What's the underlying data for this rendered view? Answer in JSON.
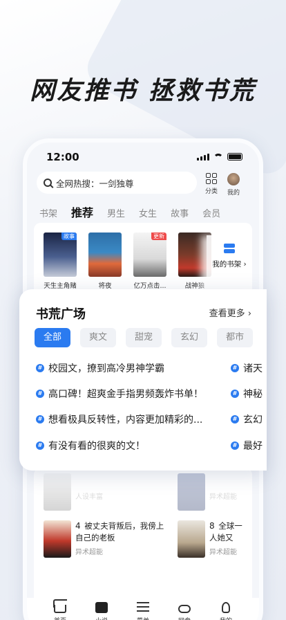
{
  "headline": "网友推书 拯救书荒",
  "status": {
    "time": "12:00"
  },
  "search": {
    "text": "全网热搜：一剑独尊"
  },
  "top_actions": {
    "category": "分类",
    "mine": "我的"
  },
  "tabs": [
    "书架",
    "推荐",
    "男生",
    "女生",
    "故事",
    "会员"
  ],
  "active_tab": "推荐",
  "shelf_books": [
    {
      "title": "天生主角赌",
      "tag": "故事"
    },
    {
      "title": "将夜",
      "tag": ""
    },
    {
      "title": "亿万点击...",
      "tag": "更新"
    },
    {
      "title": "战神狼",
      "tag": ""
    }
  ],
  "my_shelf": "我的书架 ›",
  "overlay": {
    "title": "书荒广场",
    "more": "查看更多 ›",
    "chips": [
      "全部",
      "爽文",
      "甜宠",
      "玄幻",
      "都市"
    ],
    "topics_left": [
      "校园文，撩到高冷男神学霸",
      "高口碑！超爽金手指男频轰炸书单！",
      "想看极具反转性，内容更加精彩的...",
      "有没有看的很爽的文！"
    ],
    "topics_right": [
      "诸天",
      "神秘",
      "玄幻",
      "最好"
    ]
  },
  "lower_list": [
    {
      "num": "4",
      "title": "被丈夫背叛后，我傍上自己的老板",
      "tag": "异术超能"
    },
    {
      "num": "8",
      "title": "全球一人她又",
      "tag": "异术超能"
    }
  ],
  "faded_items": {
    "left_tag": "人设丰富",
    "right_tag": "异术超能"
  },
  "bottom_nav": [
    "首页",
    "小说",
    "菜单",
    "网盘",
    "我的"
  ],
  "colors": {
    "accent": "#2b7bf0",
    "update_tag": "#ee4a4a"
  }
}
